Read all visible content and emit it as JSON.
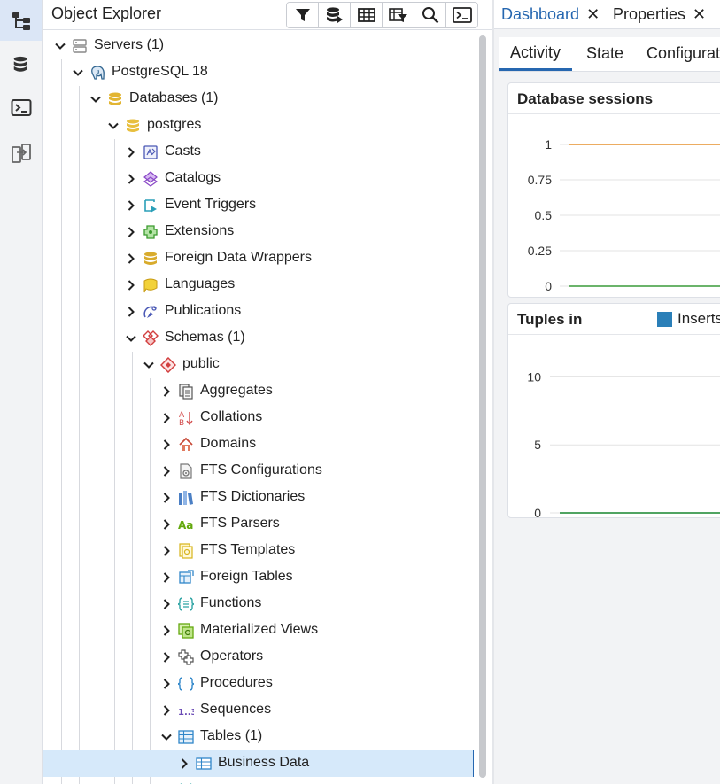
{
  "rail": {
    "items": [
      {
        "name": "object-explorer-rail-button",
        "icon": "tree-icon",
        "active": true
      },
      {
        "name": "query-tool-rail-button",
        "icon": "database-icon",
        "active": false
      },
      {
        "name": "psql-tool-rail-button",
        "icon": "terminal-icon",
        "active": false
      },
      {
        "name": "schema-diff-rail-button",
        "icon": "compare-icon",
        "active": false
      }
    ]
  },
  "explorer": {
    "title": "Object Explorer",
    "toolbar": [
      {
        "name": "filter-button",
        "icon": "filter-icon"
      },
      {
        "name": "view-data-button",
        "icon": "database-play-icon"
      },
      {
        "name": "table-button",
        "icon": "table-icon"
      },
      {
        "name": "filtered-rows-button",
        "icon": "table-filter-icon"
      },
      {
        "name": "search-button",
        "icon": "search-icon"
      },
      {
        "name": "psql-button",
        "icon": "terminal-icon"
      }
    ],
    "tree": [
      {
        "label": "Servers (1)",
        "level": 0,
        "expanded": true,
        "icon": "servers-icon"
      },
      {
        "label": "PostgreSQL 18",
        "level": 1,
        "expanded": true,
        "icon": "elephant-icon"
      },
      {
        "label": "Databases (1)",
        "level": 2,
        "expanded": true,
        "icon": "databases-icon"
      },
      {
        "label": "postgres",
        "level": 3,
        "expanded": true,
        "icon": "database-icon"
      },
      {
        "label": "Casts",
        "level": 4,
        "expanded": false,
        "icon": "casts-icon"
      },
      {
        "label": "Catalogs",
        "level": 4,
        "expanded": false,
        "icon": "catalogs-icon"
      },
      {
        "label": "Event Triggers",
        "level": 4,
        "expanded": false,
        "icon": "event-triggers-icon"
      },
      {
        "label": "Extensions",
        "level": 4,
        "expanded": false,
        "icon": "extensions-icon"
      },
      {
        "label": "Foreign Data Wrappers",
        "level": 4,
        "expanded": false,
        "icon": "foreign-data-wrappers-icon"
      },
      {
        "label": "Languages",
        "level": 4,
        "expanded": false,
        "icon": "languages-icon"
      },
      {
        "label": "Publications",
        "level": 4,
        "expanded": false,
        "icon": "publications-icon"
      },
      {
        "label": "Schemas (1)",
        "level": 4,
        "expanded": true,
        "icon": "schemas-icon"
      },
      {
        "label": "public",
        "level": 5,
        "expanded": true,
        "icon": "schema-icon"
      },
      {
        "label": "Aggregates",
        "level": 6,
        "expanded": false,
        "icon": "aggregates-icon"
      },
      {
        "label": "Collations",
        "level": 6,
        "expanded": false,
        "icon": "collations-icon"
      },
      {
        "label": "Domains",
        "level": 6,
        "expanded": false,
        "icon": "domains-icon"
      },
      {
        "label": "FTS Configurations",
        "level": 6,
        "expanded": false,
        "icon": "fts-configurations-icon"
      },
      {
        "label": "FTS Dictionaries",
        "level": 6,
        "expanded": false,
        "icon": "fts-dictionaries-icon"
      },
      {
        "label": "FTS Parsers",
        "level": 6,
        "expanded": false,
        "icon": "fts-parsers-icon"
      },
      {
        "label": "FTS Templates",
        "level": 6,
        "expanded": false,
        "icon": "fts-templates-icon"
      },
      {
        "label": "Foreign Tables",
        "level": 6,
        "expanded": false,
        "icon": "foreign-tables-icon"
      },
      {
        "label": "Functions",
        "level": 6,
        "expanded": false,
        "icon": "functions-icon"
      },
      {
        "label": "Materialized Views",
        "level": 6,
        "expanded": false,
        "icon": "materialized-views-icon"
      },
      {
        "label": "Operators",
        "level": 6,
        "expanded": false,
        "icon": "operators-icon"
      },
      {
        "label": "Procedures",
        "level": 6,
        "expanded": false,
        "icon": "procedures-icon"
      },
      {
        "label": "Sequences",
        "level": 6,
        "expanded": false,
        "icon": "sequences-icon"
      },
      {
        "label": "Tables (1)",
        "level": 6,
        "expanded": true,
        "icon": "tables-icon"
      },
      {
        "label": "Business Data",
        "level": 7,
        "expanded": false,
        "icon": "table-icon",
        "selected": true
      },
      {
        "label": "",
        "level": 6,
        "expanded": false,
        "icon": "trigger-functions-icon"
      }
    ]
  },
  "dashboard": {
    "tabs": [
      {
        "label": "Dashboard",
        "active": true
      },
      {
        "label": "Properties",
        "active": false
      }
    ],
    "close_glyph": "✕",
    "subtabs": [
      {
        "label": "Activity",
        "active": true
      },
      {
        "label": "State",
        "active": false
      },
      {
        "label": "Configurat",
        "active": false
      }
    ]
  },
  "chart_data": [
    {
      "type": "line",
      "title": "Database sessions",
      "ylim": [
        0,
        1
      ],
      "yticks": [
        "1",
        "0.75",
        "0.5",
        "0.25",
        "0"
      ],
      "series": [
        {
          "color": "#e5912d",
          "values": [
            1,
            1
          ]
        },
        {
          "color": "#3a9b3a",
          "values": [
            0,
            0
          ]
        }
      ],
      "grid": true
    },
    {
      "type": "line",
      "title": "Tuples in",
      "ylim": [
        0,
        12.5
      ],
      "yticks": [
        "10",
        "5",
        "0"
      ],
      "series": [
        {
          "name": "Inserts",
          "color": "#2a7fb8",
          "values": [
            0,
            0
          ]
        },
        {
          "color": "#3a9b3a",
          "values": [
            0,
            0
          ]
        }
      ],
      "grid": true
    }
  ]
}
